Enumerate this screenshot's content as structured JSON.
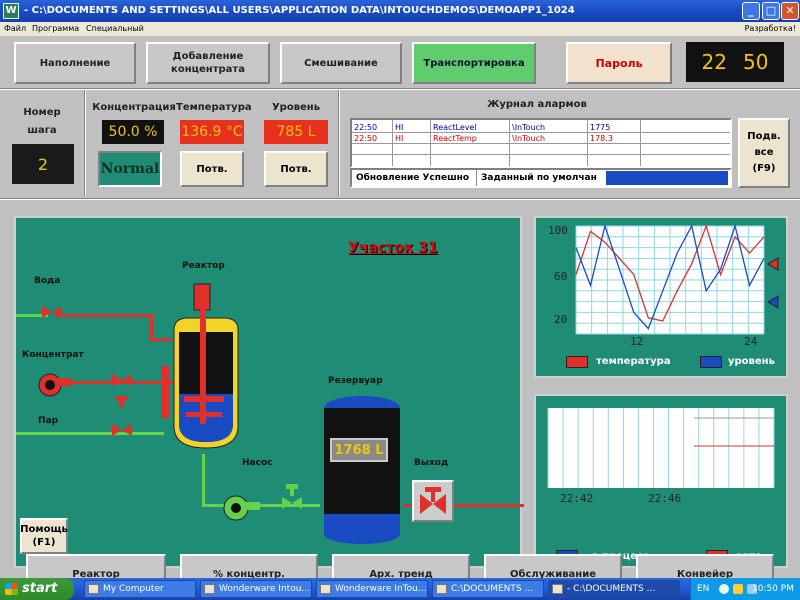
{
  "window": {
    "title": "- C:\\DOCUMENTS AND SETTINGS\\ALL USERS\\APPLICATION DATA\\INTOUCHDEMOS\\DEMOAPP1_1024",
    "buttons": [
      "_",
      "□",
      "✕"
    ]
  },
  "menu": {
    "items": [
      "Файл",
      "Программа",
      "Специальный"
    ],
    "right": "Разработка!"
  },
  "nav_top": [
    {
      "label": "Наполнение",
      "active": false
    },
    {
      "label": "Добавление концентрата",
      "active": false
    },
    {
      "label": "Смешивание",
      "active": false
    },
    {
      "label": "Транспортировка",
      "active": true
    }
  ],
  "password_label": "Пароль",
  "clock": {
    "hours": "22",
    "minutes": "50"
  },
  "step": {
    "label": "Номер шага",
    "value": "2"
  },
  "params": {
    "concentration": {
      "label": "Концентрация",
      "value": "50.0 %",
      "status": "Normal"
    },
    "temperature": {
      "label": "Температура",
      "value": "136.9 °C",
      "button": "Потв."
    },
    "level": {
      "label": "Уровень",
      "value": "785 L",
      "button": "Потв."
    }
  },
  "alarm_log": {
    "title": "Журнал алармов",
    "rows": [
      {
        "time": "22:50",
        "type": "HI",
        "tag": "ReactLevel",
        "provider": "\\InTouch",
        "value": "1775",
        "color": "#0000aa"
      },
      {
        "time": "22:50",
        "type": "HI",
        "tag": "ReactTemp",
        "provider": "\\InTouch",
        "value": "178.3",
        "color": "#cc0000"
      }
    ],
    "status_ok": "Обновление Успешно",
    "status_default": "Заданный по умолчан",
    "ack_all": [
      "Подв.",
      "все",
      "(F9)"
    ]
  },
  "process": {
    "section_title": "Участок 31",
    "labels": {
      "reactor": "Реактор",
      "water": "Вода",
      "concentrate": "Концентрат",
      "steam": "Пар",
      "reservoir": "Резервуар",
      "pump": "Насос",
      "outlet": "Выход"
    },
    "reservoir_level": "1768 L",
    "help_button": [
      "Помощь",
      "(F1)"
    ]
  },
  "trend1": {
    "y_ticks": [
      "100",
      "60",
      "20"
    ],
    "x_ticks": [
      "12",
      "24"
    ],
    "legend": [
      "температура",
      "уровень"
    ],
    "colors": {
      "temperature": "#e0302b",
      "level": "#1a4bc3"
    }
  },
  "chart_data": [
    {
      "type": "line",
      "x": [
        0,
        2,
        4,
        6,
        8,
        10,
        12,
        14,
        16,
        18,
        20,
        22,
        24,
        26
      ],
      "series": [
        {
          "name": "температура",
          "values": [
            55,
            95,
            85,
            70,
            55,
            15,
            12,
            40,
            65,
            100,
            55,
            90,
            75,
            90
          ]
        },
        {
          "name": "уровень",
          "values": [
            80,
            45,
            100,
            60,
            20,
            5,
            40,
            75,
            100,
            40,
            60,
            100,
            45,
            70
          ]
        }
      ],
      "ylim": [
        0,
        100
      ]
    }
  ],
  "trend2": {
    "x_ticks": [
      "22:42",
      "22:46"
    ],
    "legend": [
      "в процесе",
      "авто"
    ]
  },
  "nav_bottom": [
    "Реактор",
    "% концентр.",
    "Арх. тренд",
    "Обслуживание",
    "Конвейер"
  ],
  "taskbar": {
    "start": "start",
    "tasks": [
      "My Computer",
      "Wonderware Intou...",
      "Wonderware InTou...",
      "C:\\DOCUMENTS ...",
      "- C:\\DOCUMENTS ..."
    ],
    "lang": "EN",
    "time": "10:50 PM"
  }
}
